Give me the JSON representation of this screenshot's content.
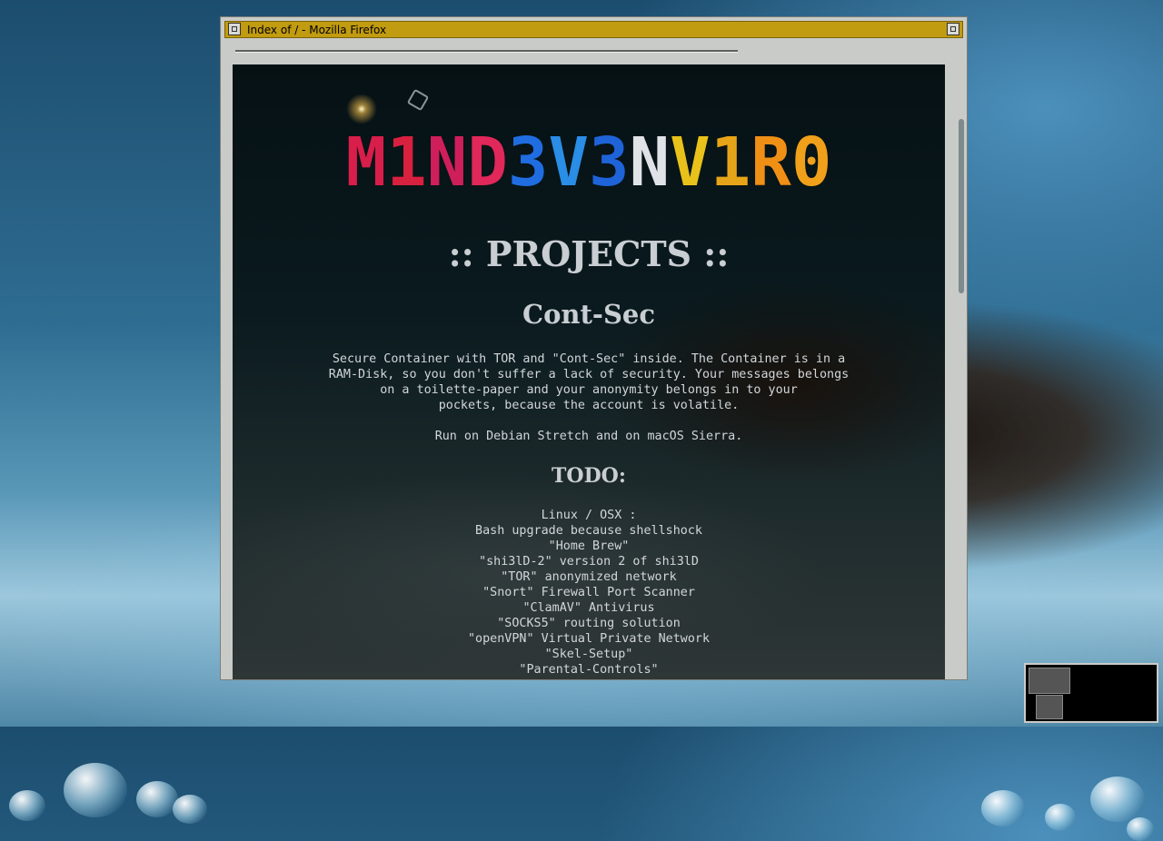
{
  "window": {
    "title": "Index of / - Mozilla Firefox",
    "titlebar_color": "#c19b10"
  },
  "page": {
    "logo_letters": [
      {
        "ch": "M",
        "color": "#d81e4a"
      },
      {
        "ch": "1",
        "color": "#d8203f"
      },
      {
        "ch": "N",
        "color": "#cf1f5a"
      },
      {
        "ch": "D",
        "color": "#e0285a"
      },
      {
        "ch": "3",
        "color": "#1f6de0"
      },
      {
        "ch": "V",
        "color": "#2a8de6"
      },
      {
        "ch": "3",
        "color": "#1e63d8"
      },
      {
        "ch": "N",
        "color": "#dfe2e6"
      },
      {
        "ch": "V",
        "color": "#e8c21a"
      },
      {
        "ch": "1",
        "color": "#e6a418"
      },
      {
        "ch": "R",
        "color": "#ef8f16"
      },
      {
        "ch": "0",
        "color": "#f0a01a"
      }
    ],
    "heading": ":: PROJECTS ::",
    "project_title": "Cont-Sec",
    "description": [
      "Secure Container with TOR and \"Cont-Sec\" inside. The Container is in a",
      "RAM-Disk, so you don't suffer a lack of security. Your messages belongs",
      "on a toilette-paper and your anonymity belongs in to your",
      "pockets, because the account is volatile."
    ],
    "run_on": "Run on Debian Stretch and on macOS Sierra.",
    "todo_heading": "TODO:",
    "todo_items": [
      "Linux / OSX :",
      "Bash upgrade because shellshock",
      "\"Home Brew\"",
      "\"shi3lD-2\" version 2 of shi3lD",
      "\"TOR\" anonymized network",
      "\"Snort\" Firewall Port Scanner",
      "\"ClamAV\" Antivirus",
      "\"SOCKS5\" routing solution",
      "\"openVPN\" Virtual Private Network",
      "\"Skel-Setup\"",
      "\"Parental-Controls\""
    ]
  }
}
